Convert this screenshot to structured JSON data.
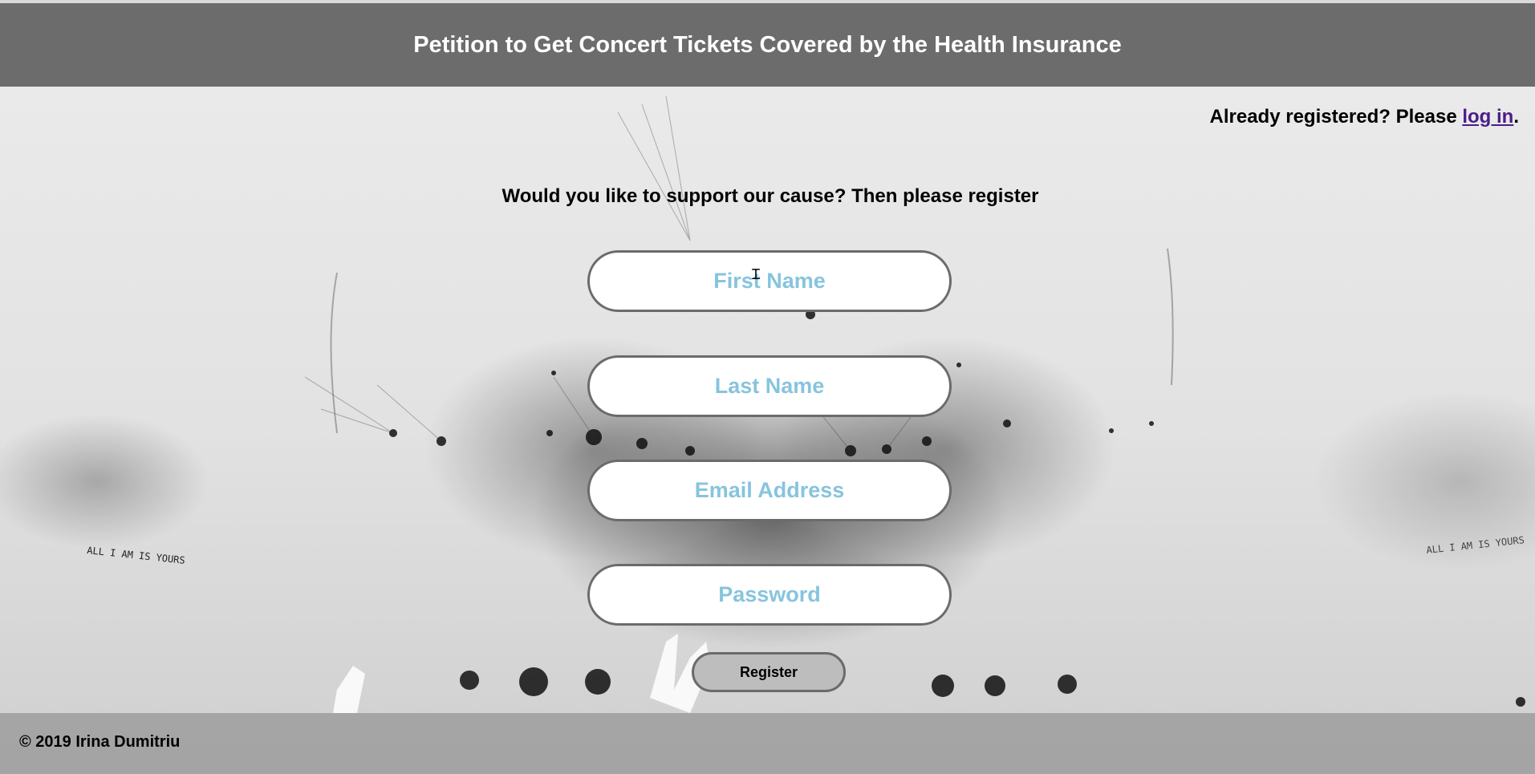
{
  "header": {
    "title": "Petition to Get Concert Tickets Covered by the Health Insurance"
  },
  "login_note": {
    "prefix": "Already registered? Please ",
    "link": "log in",
    "suffix": "."
  },
  "intro": "Would you like to support our cause? Then please register",
  "form": {
    "first_name_placeholder": "First Name",
    "last_name_placeholder": "Last Name",
    "email_placeholder": "Email Address",
    "password_placeholder": "Password",
    "register_label": "Register"
  },
  "footer": {
    "copyright": "© 2019 Irina Dumitriu"
  },
  "background": {
    "text_left": "ALL I AM IS YOURS",
    "text_right": "ALL I AM IS YOURS"
  },
  "colors": {
    "header_bg": "#5a5a5a",
    "placeholder": "#87c4de",
    "link": "#4b1d8a",
    "button_bg": "#bdbdbd"
  },
  "icons": {
    "cursor": "text-cursor-icon"
  }
}
